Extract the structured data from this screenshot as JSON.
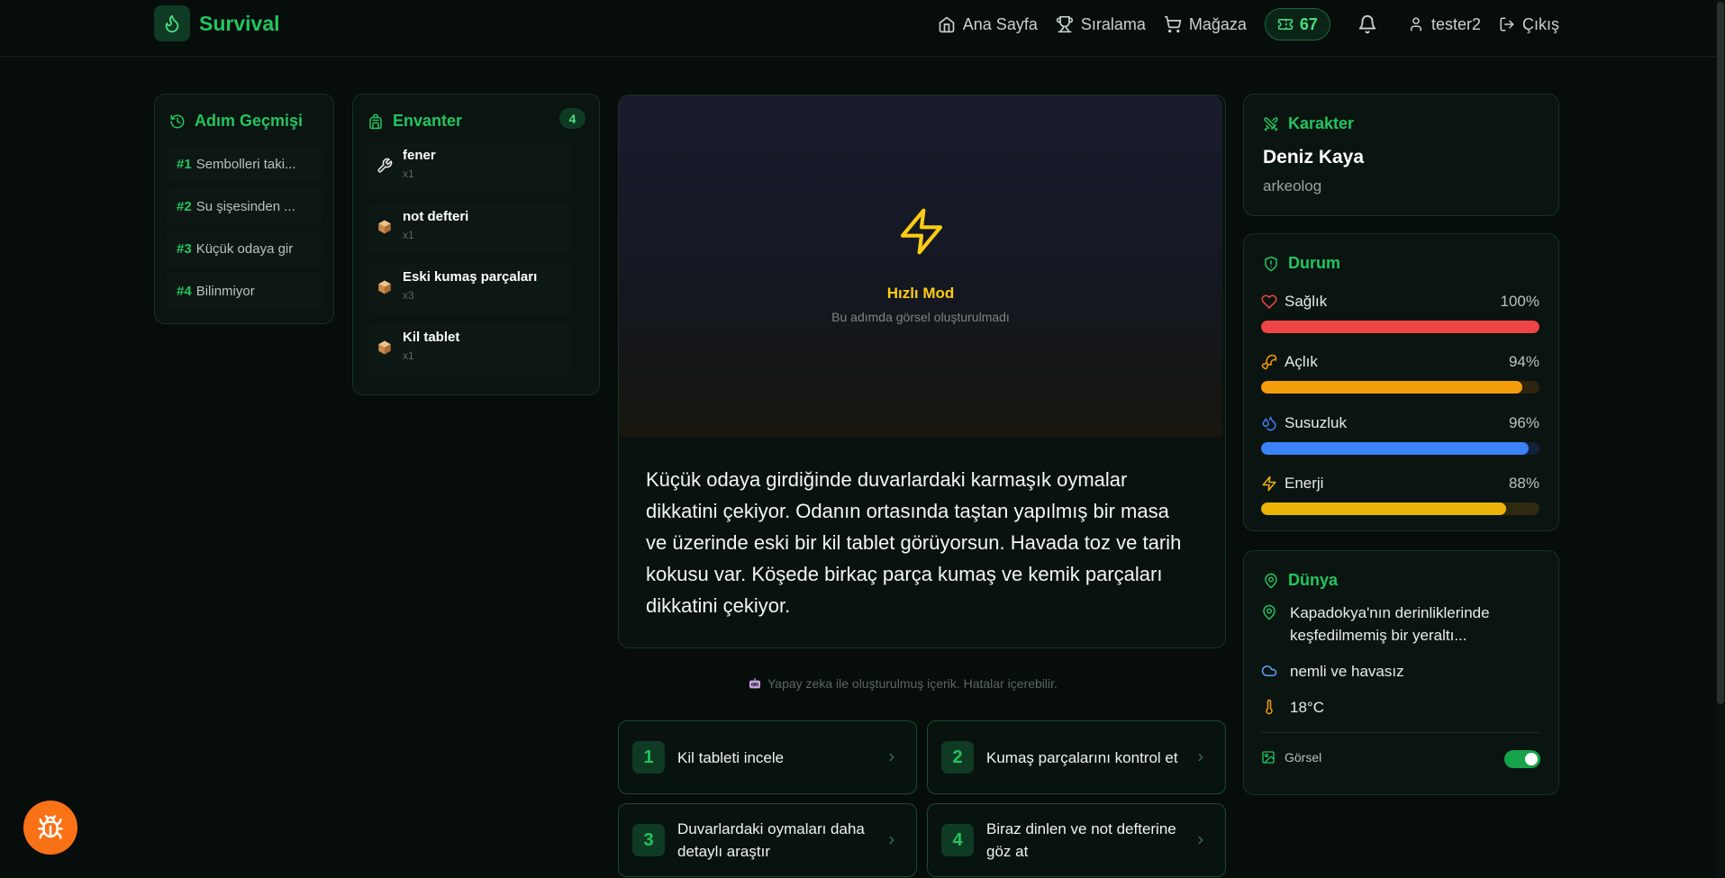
{
  "app": {
    "brand": "Survival"
  },
  "nav": {
    "home": "Ana Sayfa",
    "ranking": "Sıralama",
    "shop": "Mağaza",
    "coins": "67",
    "user": "tester2",
    "logout": "Çıkış"
  },
  "history": {
    "title": "Adım Geçmişi",
    "items": [
      {
        "num": "#1",
        "text": "Sembolleri taki..."
      },
      {
        "num": "#2",
        "text": "Su şişesinden ..."
      },
      {
        "num": "#3",
        "text": "Küçük odaya gir"
      },
      {
        "num": "#4",
        "text": "Bilinmiyor"
      }
    ]
  },
  "inventory": {
    "title": "Envanter",
    "count": "4",
    "items": [
      {
        "name": "fener",
        "qty": "x1",
        "icon": "wrench-icon"
      },
      {
        "name": "not defteri",
        "qty": "x1",
        "icon": "package-icon"
      },
      {
        "name": "Eski kumaş parçaları",
        "qty": "x3",
        "icon": "package-icon"
      },
      {
        "name": "Kil tablet",
        "qty": "x1",
        "icon": "package-icon"
      }
    ]
  },
  "scene": {
    "mode": "Hızlı Mod",
    "mode_note": "Bu adımda görsel oluşturulmadı",
    "text": "Küçük odaya girdiğinde duvarlardaki karmaşık oymalar dikkatini çekiyor. Odanın ortasında taştan yapılmış bir masa ve üzerinde eski bir kil tablet görüyorsun. Havada toz ve tarih kokusu var. Köşede birkaç parça kumaş ve kemik parçaları dikkatini çekiyor.",
    "disclaimer": "Yapay zeka ile oluşturulmuş içerik. Hatalar içerebilir."
  },
  "choices": [
    {
      "num": "1",
      "text": "Kil tableti incele"
    },
    {
      "num": "2",
      "text": "Kumaş parçalarını kontrol et"
    },
    {
      "num": "3",
      "text": "Duvarlardaki oymaları daha detaylı araştır"
    },
    {
      "num": "4",
      "text": "Biraz dinlen ve not defterine göz at"
    }
  ],
  "character": {
    "title": "Karakter",
    "name": "Deniz Kaya",
    "role": "arkeolog"
  },
  "status": {
    "title": "Durum",
    "stats": [
      {
        "label": "Sağlık",
        "pct_label": "100%",
        "value": 100,
        "color": "#ef4444",
        "track": "#3a1414",
        "icon": "heart-icon"
      },
      {
        "label": "Açlık",
        "pct_label": "94%",
        "value": 94,
        "color": "#f59e0b",
        "track": "#2e2410",
        "icon": "drumstick-icon"
      },
      {
        "label": "Susuzluk",
        "pct_label": "96%",
        "value": 96,
        "color": "#3b82f6",
        "track": "#12223a",
        "icon": "droplets-icon"
      },
      {
        "label": "Enerji",
        "pct_label": "88%",
        "value": 88,
        "color": "#eab308",
        "track": "#2e2a10",
        "icon": "zap-icon"
      }
    ]
  },
  "world": {
    "title": "Dünya",
    "location": "Kapadokya'nın derinliklerinde keşfedilmemiş bir yeraltı...",
    "weather": "nemli ve havasız",
    "temperature": "18°C",
    "visual_label": "Görsel",
    "visual_on": true
  }
}
